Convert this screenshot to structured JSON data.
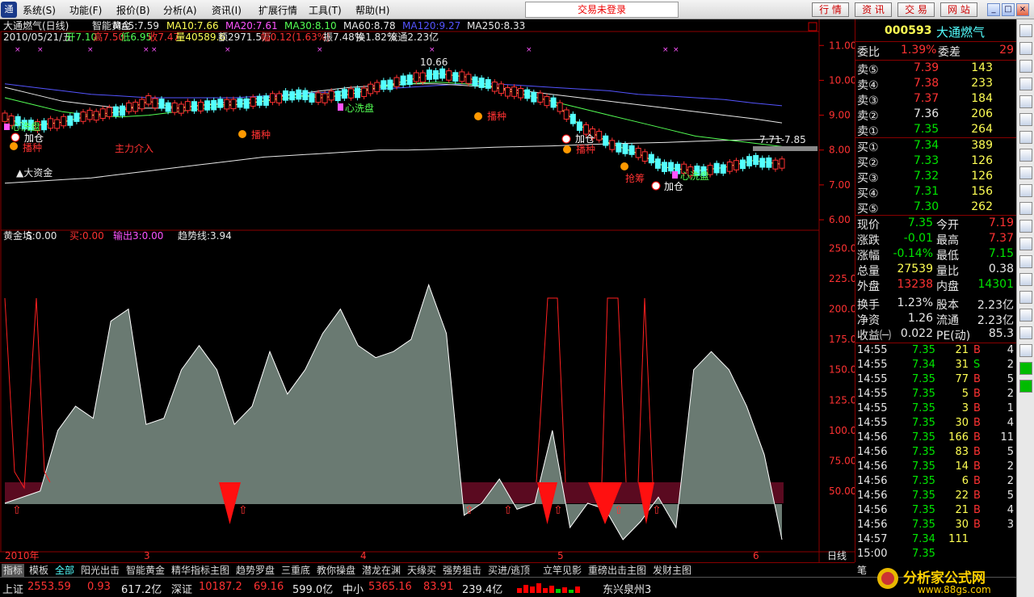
{
  "menu": {
    "logo": "通",
    "items": [
      "系统(S)",
      "功能(F)",
      "报价(B)",
      "分析(A)",
      "资讯(I)",
      "扩展行情",
      "工具(T)",
      "帮助(H)"
    ],
    "notice": "交易未登录",
    "buttons": [
      "行 情",
      "资 讯",
      "交 易",
      "网 站"
    ]
  },
  "chart": {
    "title": "大通燃气(日线)",
    "formula": "智能黄金",
    "ma": [
      {
        "t": "MA5:7.59",
        "c": "#e8e8e8"
      },
      {
        "t": "MA10:7.66",
        "c": "#ffff54"
      },
      {
        "t": "MA20:7.61",
        "c": "#ff54ff"
      },
      {
        "t": "MA30:8.10",
        "c": "#54ff54"
      },
      {
        "t": "MA60:8.78",
        "c": "#e8e8e8"
      },
      {
        "t": "MA120:9.27",
        "c": "#5454ff"
      },
      {
        "t": "MA250:8.33",
        "c": "#e8e8e8"
      }
    ],
    "info": [
      {
        "t": "2010/05/21/五",
        "c": "#e8e8e8"
      },
      {
        "t": "开7.10",
        "c": "#54ff54"
      },
      {
        "t": "高7.50",
        "c": "#ff3232"
      },
      {
        "t": "低6.95",
        "c": "#54ff54"
      },
      {
        "t": "收7.47",
        "c": "#ff3232"
      },
      {
        "t": "量40589.6",
        "c": "#ffff54"
      },
      {
        "t": "额2971.5万",
        "c": "#e8e8e8"
      },
      {
        "t": "幅0.12(1.63%)",
        "c": "#ff3232"
      },
      {
        "t": "振7.48%",
        "c": "#e8e8e8"
      },
      {
        "t": "换1.82%",
        "c": "#e8e8e8"
      },
      {
        "t": "流通2.23亿",
        "c": "#e8e8e8"
      }
    ],
    "price_axis": [
      "11.00",
      "10.00",
      "9.00",
      "8.00",
      "7.00",
      "6.00"
    ],
    "ind_title": "黄金坑",
    "ind_vals": [
      {
        "t": "S:0.00",
        "c": "#e8e8e8"
      },
      {
        "t": "买:0.00",
        "c": "#ff3232"
      },
      {
        "t": "输出3:0.00",
        "c": "#ff54ff"
      },
      {
        "t": "趋势线:3.94",
        "c": "#e8e8e8"
      }
    ],
    "ind_axis": [
      "250.00",
      "225.00",
      "200.00",
      "175.00",
      "150.00",
      "125.00",
      "100.00",
      "75.00",
      "50.00"
    ],
    "date_labels": [
      "2010年",
      "3",
      "4",
      "5",
      "6"
    ],
    "period": "日线",
    "ann": {
      "high": "10.66",
      "range": "7.71-7.85",
      "big": "▲大资金",
      "main": "主力介入",
      "bo1": "播种",
      "bo2": "播种",
      "bo3": "播种",
      "bo4": "播种",
      "add1": "加仓",
      "add2": "加仓",
      "add3": "加仓",
      "wash1": "心洗盘",
      "wash2": "心洗盘",
      "wash3": "心洗盘",
      "grab": "抢筹"
    }
  },
  "quote": {
    "code": "000593",
    "name": "大通燃气",
    "ratio_l": "委比",
    "ratio_v": "1.39%",
    "diff_l": "委差",
    "diff_v": "29",
    "sell": [
      {
        "l": "卖⑤",
        "p": "7.39",
        "v": "143"
      },
      {
        "l": "卖④",
        "p": "7.38",
        "v": "233"
      },
      {
        "l": "卖③",
        "p": "7.37",
        "v": "184"
      },
      {
        "l": "卖②",
        "p": "7.36",
        "v": "206"
      },
      {
        "l": "卖①",
        "p": "7.35",
        "v": "264"
      }
    ],
    "buy": [
      {
        "l": "买①",
        "p": "7.34",
        "v": "389"
      },
      {
        "l": "买②",
        "p": "7.33",
        "v": "126"
      },
      {
        "l": "买③",
        "p": "7.32",
        "v": "126"
      },
      {
        "l": "买④",
        "p": "7.31",
        "v": "156"
      },
      {
        "l": "买⑤",
        "p": "7.30",
        "v": "262"
      }
    ],
    "stats": [
      [
        "现价",
        "7.35",
        "今开",
        "7.19"
      ],
      [
        "涨跌",
        "-0.01",
        "最高",
        "7.37"
      ],
      [
        "涨幅",
        "-0.14%",
        "最低",
        "7.15"
      ],
      [
        "总量",
        "27539",
        "量比",
        "0.38"
      ],
      [
        "外盘",
        "13238",
        "内盘",
        "14301"
      ],
      [
        "换手",
        "1.23%",
        "股本",
        "2.23亿"
      ],
      [
        "净资",
        "1.26",
        "流通",
        "2.23亿"
      ],
      [
        "收益㈠",
        "0.022",
        "PE(动)",
        "85.3"
      ]
    ],
    "ticks": [
      [
        "14:55",
        "7.35",
        "21",
        "B",
        "4"
      ],
      [
        "14:55",
        "7.34",
        "31",
        "S",
        "2"
      ],
      [
        "14:55",
        "7.35",
        "77",
        "B",
        "5"
      ],
      [
        "14:55",
        "7.35",
        "5",
        "B",
        "2"
      ],
      [
        "14:55",
        "7.35",
        "3",
        "B",
        "1"
      ],
      [
        "14:55",
        "7.35",
        "30",
        "B",
        "4"
      ],
      [
        "14:56",
        "7.35",
        "166",
        "B",
        "11"
      ],
      [
        "14:56",
        "7.35",
        "83",
        "B",
        "5"
      ],
      [
        "14:56",
        "7.35",
        "14",
        "B",
        "2"
      ],
      [
        "14:56",
        "7.35",
        "6",
        "B",
        "2"
      ],
      [
        "14:56",
        "7.35",
        "22",
        "B",
        "5"
      ],
      [
        "14:56",
        "7.35",
        "21",
        "B",
        "4"
      ],
      [
        "14:56",
        "7.35",
        "30",
        "B",
        "3"
      ],
      [
        "14:57",
        "7.34",
        "111",
        "",
        ""
      ],
      [
        "15:00",
        "7.35",
        "",
        "",
        ""
      ]
    ],
    "bottom_tab": "笔"
  },
  "tabs": [
    "指标",
    "模板",
    "全部",
    "阳光出击",
    "智能黄金",
    "精华指标主图",
    "趋势罗盘",
    "三重底",
    "教你操盘",
    "潜龙在渊",
    "天缘买",
    "强势狙击",
    "买进/逃顶",
    "立竿见影",
    "重磅出击主图",
    "发财主图"
  ],
  "status": {
    "sh_l": "上证",
    "sh_v": "2553.59",
    "sh_c": "0.93",
    "sh_a": "617.2亿",
    "sz_l": "深证",
    "sz_v": "10187.2",
    "sz_c": "69.16",
    "sz_a": "599.0亿",
    "zx_l": "中小",
    "zx_v": "5365.16",
    "zx_c": "83.91",
    "zx_a": "239.4亿",
    "stock": "东兴泉州3",
    "watermark": "分析家公式网",
    "wm_url": "www.88gs.com"
  },
  "chart_data": [
    {
      "type": "candlestick",
      "title": "大通燃气(日线)",
      "ylim": [
        5.7,
        11.4
      ],
      "yticks": [
        11,
        10,
        9,
        8,
        7,
        6
      ],
      "ma_series": [
        {
          "name": "MA250",
          "color": "#e8e8e8",
          "values": [
            7.05,
            7.1,
            7.15,
            7.2,
            7.3,
            7.4,
            7.5,
            7.6,
            7.7,
            7.8,
            7.85,
            7.9,
            7.95,
            8.0,
            8.0,
            8.02,
            8.05,
            8.08,
            8.1,
            8.12,
            8.15,
            8.18,
            8.2,
            8.22,
            8.25,
            8.28,
            8.3,
            8.33
          ]
        },
        {
          "name": "MA120",
          "color": "#5454ff",
          "values": [
            9.9,
            9.8,
            9.7,
            9.6,
            9.55,
            9.5,
            9.5,
            9.5,
            9.5,
            9.55,
            9.6,
            9.65,
            9.7,
            9.75,
            9.8,
            9.85,
            9.9,
            9.9,
            9.85,
            9.8,
            9.75,
            9.7,
            9.6,
            9.55,
            9.5,
            9.45,
            9.35,
            9.27
          ]
        },
        {
          "name": "MA60",
          "color": "#e8e8e8",
          "values": [
            9.8,
            9.6,
            9.4,
            9.3,
            9.2,
            9.2,
            9.2,
            9.3,
            9.4,
            9.5,
            9.6,
            9.7,
            9.8,
            9.85,
            9.9,
            9.9,
            9.85,
            9.8,
            9.7,
            9.6,
            9.5,
            9.4,
            9.3,
            9.2,
            9.1,
            9.0,
            8.9,
            8.78
          ]
        },
        {
          "name": "MA30",
          "color": "#54ff54",
          "values": [
            9.5,
            9.3,
            9.1,
            9.0,
            8.95,
            9.0,
            9.1,
            9.2,
            9.3,
            9.4,
            9.5,
            9.6,
            9.7,
            9.8,
            9.9,
            9.95,
            9.9,
            9.8,
            9.6,
            9.4,
            9.2,
            9.0,
            8.8,
            8.6,
            8.4,
            8.3,
            8.2,
            8.1
          ]
        },
        {
          "name": "MA5",
          "color": "#ffff54",
          "values": [
            8.9,
            8.7,
            8.8,
            9.0,
            9.1,
            9.4,
            9.2,
            9.3,
            9.3,
            9.4,
            9.6,
            9.5,
            9.6,
            9.8,
            10.0,
            10.2,
            10.1,
            9.8,
            9.6,
            9.4,
            8.7,
            8.2,
            7.9,
            7.5,
            7.4,
            7.5,
            7.7,
            7.59
          ]
        }
      ]
    },
    {
      "type": "area",
      "title": "黄金坑",
      "ylim": [
        0,
        265
      ],
      "yticks": [
        250,
        225,
        200,
        175,
        150,
        125,
        100,
        75,
        50
      ],
      "series": [
        {
          "name": "S",
          "values": [
            40,
            45,
            50,
            100,
            120,
            110,
            190,
            200,
            105,
            110,
            150,
            170,
            150,
            105,
            120,
            165,
            130,
            150,
            180,
            200,
            170,
            160,
            165,
            175,
            220,
            180,
            30,
            40,
            60,
            35,
            40,
            100,
            20,
            40,
            35,
            10,
            25,
            45,
            20,
            150,
            165,
            150,
            120,
            80,
            10
          ]
        }
      ]
    }
  ]
}
